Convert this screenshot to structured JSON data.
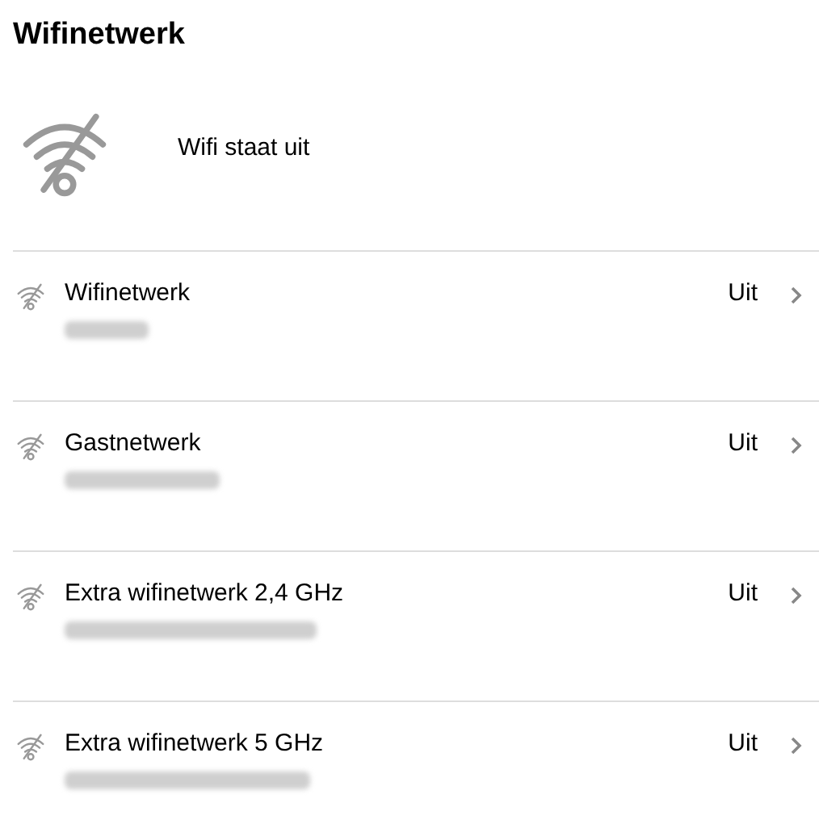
{
  "title": "Wifinetwerk",
  "status": {
    "text": "Wifi staat uit",
    "on": false
  },
  "networks": [
    {
      "name": "Wifinetwerk",
      "state": "Uit",
      "on": false,
      "ssid_redacted": true
    },
    {
      "name": "Gastnetwerk",
      "state": "Uit",
      "on": false,
      "ssid_redacted": true
    },
    {
      "name": "Extra wifinetwerk 2,4 GHz",
      "state": "Uit",
      "on": false,
      "ssid_redacted": true
    },
    {
      "name": "Extra wifinetwerk 5 GHz",
      "state": "Uit",
      "on": false,
      "ssid_redacted": true
    }
  ]
}
